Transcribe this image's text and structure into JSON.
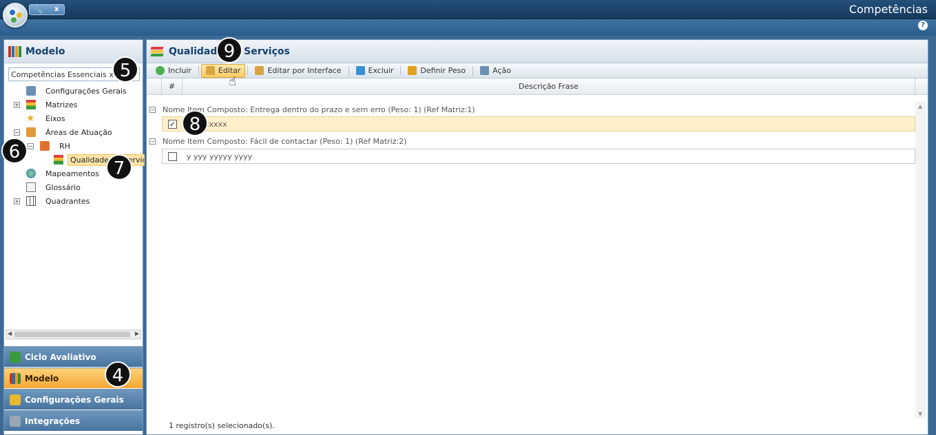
{
  "app": {
    "title": "Competências",
    "help": "?",
    "tab_close": "x"
  },
  "left": {
    "header": "Modelo",
    "combo_value": "Competências Essenciais x Esp",
    "tree": [
      {
        "label": "Configurações Gerais",
        "icon": "settings-icon"
      },
      {
        "label": "Matrizes",
        "icon": "stack-icon",
        "expander": "+"
      },
      {
        "label": "Eixos",
        "icon": "star-icon"
      },
      {
        "label": "Áreas de Atuação",
        "icon": "folder-icon",
        "expander": "−"
      },
      {
        "label": "RH",
        "icon": "folder-icon",
        "expander": "−"
      },
      {
        "label": "Qualidade de Serviço",
        "icon": "stack-icon"
      },
      {
        "label": "Mapeamentos",
        "icon": "globe-icon"
      },
      {
        "label": "Glossário",
        "icon": "book-icon"
      },
      {
        "label": "Quadrantes",
        "icon": "grid-icon",
        "expander": "+"
      }
    ],
    "nav": [
      {
        "label": "Ciclo Avaliativo"
      },
      {
        "label": "Modelo"
      },
      {
        "label": "Configurações Gerais"
      },
      {
        "label": "Integrações"
      }
    ]
  },
  "main": {
    "header": "Qualidade de Serviços",
    "toolbar": {
      "incluir": "Incluir",
      "editar": "Editar",
      "editar_interface": "Editar por Interface",
      "excluir": "Excluir",
      "definir_peso": "Definir Peso",
      "acao": "Ação"
    },
    "columns": {
      "num": "#",
      "descricao": "Descrição Frase"
    },
    "groups": [
      {
        "title": "Nome Item Composto: Entrega dentro do prazo e sem erro (Peso: 1) (Ref Matriz:1)",
        "row_text": "xxxxxxxxx",
        "checked": "✓"
      },
      {
        "title": "Nome Item Composto: Fácil de contactar (Peso: 1) (Ref Matriz:2)",
        "row_text": "y yyy yyyyy yyyy",
        "checked": ""
      }
    ],
    "status": "1 registro(s) selecionado(s)."
  },
  "badges": {
    "b4": "4",
    "b5": "5",
    "b6": "6",
    "b7": "7",
    "b8": "8",
    "b9": "9"
  },
  "colors": {
    "accent": "#f6a734",
    "header_text": "#15436f",
    "nav_bg": "#47749f"
  }
}
